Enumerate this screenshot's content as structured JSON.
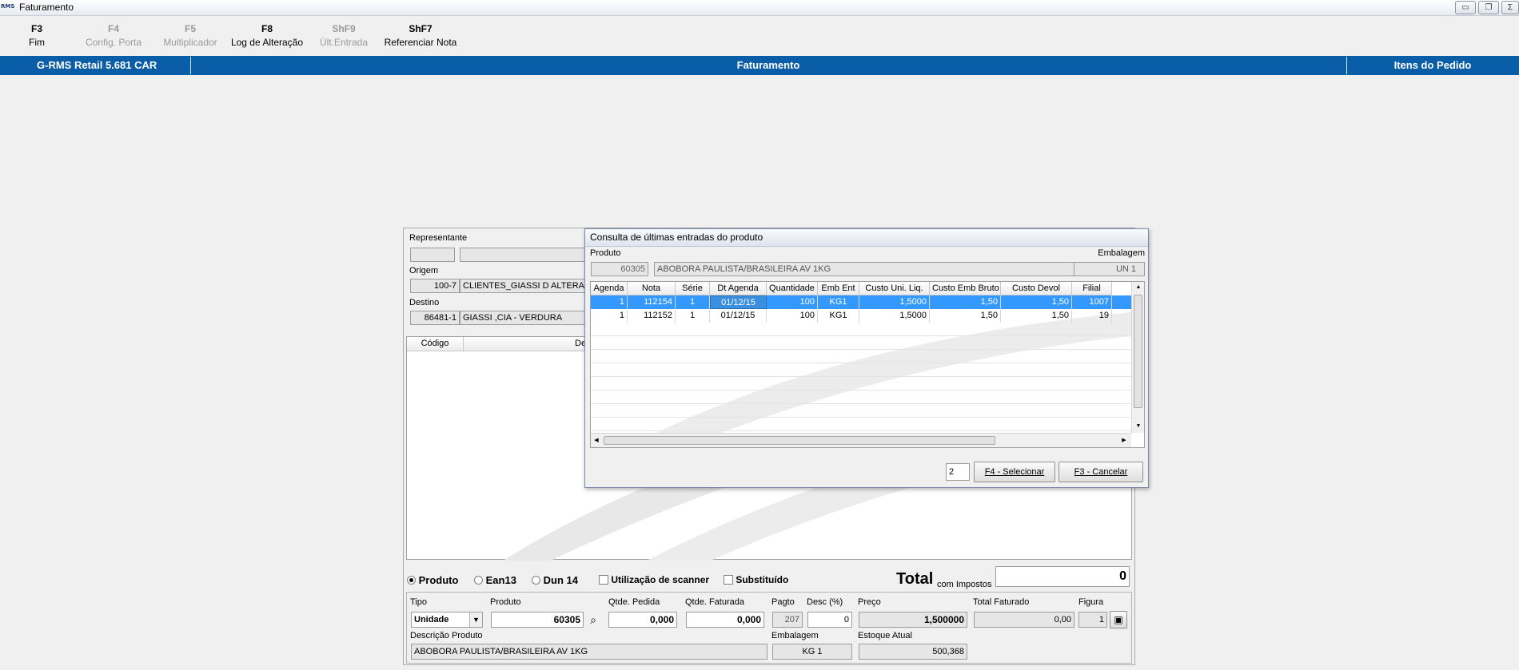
{
  "window": {
    "icon_text": "RMS",
    "title": "Faturamento",
    "min_glyph": "▭",
    "restore_glyph": "❐",
    "close_glyph": "Σ"
  },
  "toolbar": [
    {
      "key": "F3",
      "label": "Fim",
      "enabled": true
    },
    {
      "key": "F4",
      "label": "Config. Porta",
      "enabled": false
    },
    {
      "key": "F5",
      "label": "Multiplicador",
      "enabled": false
    },
    {
      "key": "F8",
      "label": "Log de Alteração",
      "enabled": true
    },
    {
      "key": "ShF9",
      "label": "Últ.Entrada",
      "enabled": false
    },
    {
      "key": "ShF7",
      "label": "Referenciar Nota",
      "enabled": true
    }
  ],
  "bluebar": {
    "app": "G-RMS Retail 5.681 CAR",
    "module": "Faturamento",
    "section": "Itens do Pedido"
  },
  "form": {
    "representante_label": "Representante",
    "representante_code": "",
    "representante_name": "",
    "origem_label": "Origem",
    "origem_code": "100-7",
    "origem_name": "CLIENTES_GIASSI D ALTERADO",
    "destino_label": "Destino",
    "destino_code": "86481-1",
    "destino_name": "GIASSI ,CIA - VERDURA",
    "items_header_codigo": "Código",
    "items_header_desc": "De",
    "mode_produto": "Produto",
    "mode_ean13": "Ean13",
    "mode_dun14": "Dun 14",
    "scanner_label": "Utilização de scanner",
    "substituido_label": "Substituído",
    "total_label": "Total",
    "total_sub": "com Impostos",
    "total_value": "0",
    "tipo_label": "Tipo",
    "tipo_value": "Unidade",
    "produto_label": "Produto",
    "produto_value": "60305",
    "qtde_pedida_label": "Qtde. Pedida",
    "qtde_pedida_value": "0,000",
    "qtde_faturada_label": "Qtde. Faturada",
    "qtde_faturada_value": "0,000",
    "pagto_label": "Pagto",
    "pagto_value": "207",
    "desc_label": "Desc (%)",
    "desc_value": "0",
    "preco_label": "Preço",
    "preco_value": "1,500000",
    "total_faturado_label": "Total Faturado",
    "total_faturado_value": "0,00",
    "figura_label": "Figura",
    "figura_value": "1",
    "descricao_label": "Descrição Produto",
    "descricao_value": "ABOBORA PAULISTA/BRASILEIRA     AV   1KG",
    "embalagem_label": "Embalagem",
    "embalagem_value": "KG    1",
    "estoque_label": "Estoque Atual",
    "estoque_value": "500,368"
  },
  "dialog": {
    "title": "Consulta de últimas entradas do produto",
    "produto_label": "Produto",
    "produto_code": "60305",
    "produto_desc": "ABOBORA PAULISTA/BRASILEIRA     AV   1KG",
    "embalagem_label": "Embalagem",
    "embalagem_value": "UN    1",
    "columns": [
      "Agenda",
      "Nota",
      "Série",
      "Dt Agenda",
      "Quantidade",
      "Emb Ent",
      "Custo Uni. Liq.",
      "Custo Emb Bruto",
      "Custo Devol",
      "Filial"
    ],
    "rows": [
      [
        "1",
        "112154",
        "1",
        "01/12/15",
        "100",
        "KG1",
        "1,5000",
        "1,50",
        "1,50",
        "1007"
      ],
      [
        "1",
        "112152",
        "1",
        "01/12/15",
        "100",
        "KG1",
        "1,5000",
        "1,50",
        "1,50",
        "19"
      ]
    ],
    "selected_row": 0,
    "count_value": "2",
    "select_btn_key": "F4",
    "select_btn_text": " - Selecionar",
    "cancel_btn_key": "F3",
    "cancel_btn_text": " - Cancelar"
  }
}
